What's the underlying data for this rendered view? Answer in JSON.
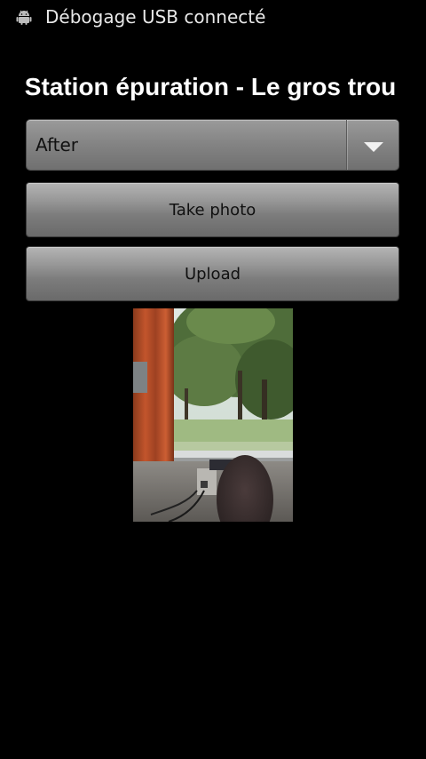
{
  "status_bar": {
    "notification_icon": "android-debug-icon",
    "notification_text": "Débogage USB connecté"
  },
  "title": "Station épuration - Le gros trou",
  "spinner": {
    "selected_value": "After",
    "icon": "dropdown-arrow-icon"
  },
  "buttons": {
    "take_photo_label": "Take photo",
    "upload_label": "Upload"
  },
  "colors": {
    "background": "#000000",
    "text": "#ffffff",
    "button_text": "#111111"
  }
}
